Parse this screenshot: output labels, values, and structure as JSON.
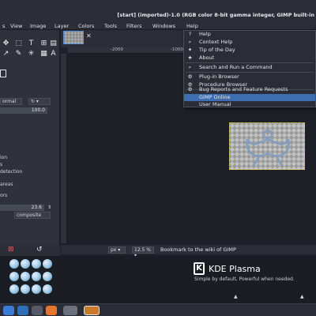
{
  "window": {
    "title": "[start] (imported)-1.0 (RGB color 8-bit gamma integer, GIMP built-in"
  },
  "menubar": {
    "items": [
      "s",
      "View",
      "Image",
      "Layer",
      "Colors",
      "Tools",
      "Filters",
      "Windows",
      "Help"
    ]
  },
  "toolbox": {
    "mode_value": "ormal",
    "opacity_value": "100.0",
    "options": [
      "ion",
      "s",
      "detection",
      "areas",
      "ors"
    ],
    "threshold_value": "23.6",
    "composite_value": "composite"
  },
  "ruler": {
    "labels": [
      "-2000",
      "-1000"
    ]
  },
  "statusbar": {
    "unit": "px",
    "zoom": "12.5 %",
    "message": "Bookmark to the wiki of GIMP"
  },
  "help_menu": {
    "items": [
      {
        "label": "Help",
        "icon": "help-icon"
      },
      {
        "label": "Context Help",
        "icon": "context-help-icon"
      },
      {
        "label": "Tip of the Day",
        "icon": "tip-icon"
      },
      {
        "label": "About",
        "icon": "about-icon"
      },
      {
        "label": "Search and Run a Command",
        "icon": "search-icon"
      },
      {
        "label": "Plug-in Browser",
        "icon": "plugin-icon"
      },
      {
        "label": "Procedure Browser",
        "icon": "procedure-icon"
      },
      {
        "label": "Bug Reports and Feature Requests",
        "icon": "bug-icon"
      },
      {
        "label": "GIMP Online",
        "icon": ""
      },
      {
        "label": "User Manual",
        "icon": ""
      }
    ],
    "selected": "GIMP Online"
  },
  "desktop": {
    "brand": "KDE Plasma",
    "tagline": "Simple by default, Powerful when needed."
  },
  "colors": {
    "accent": "#3d6fb0",
    "menu_bg": "#2a2d35",
    "window_bg": "#2b2e36"
  }
}
